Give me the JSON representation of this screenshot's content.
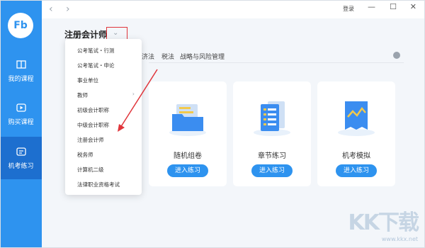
{
  "app": {
    "logo_text": "Fb"
  },
  "sidebar": {
    "items": [
      {
        "label": "我的课程"
      },
      {
        "label": "购买课程"
      },
      {
        "label": "机考练习"
      }
    ]
  },
  "topbar": {
    "back": "‹",
    "forward": "›",
    "login": "登录",
    "minimize": "—",
    "maximize": "☐",
    "close": "✕"
  },
  "header": {
    "subject": "注册会计师",
    "chevron": "⌄"
  },
  "tabs": [
    "济法",
    "税法",
    "战略与风险管理"
  ],
  "dropdown": {
    "items": [
      "公考笔试・行测",
      "公考笔试・申论",
      "事业单位",
      "教师",
      "初级会计职称",
      "中级会计职称",
      "注册会计师",
      "税务师",
      "计算机二级",
      "法律职业资格考试"
    ],
    "caret": "›"
  },
  "cards": [
    {
      "name": "随机组卷",
      "button": "进入练习"
    },
    {
      "name": "章节练习",
      "button": "进入练习"
    },
    {
      "name": "机考模拟",
      "button": "进入练习"
    }
  ],
  "watermark": {
    "logo": "KK下载",
    "url": "www.kkx.net"
  },
  "colors": {
    "accent": "#2e93ef",
    "active_nav": "#1d6fcf",
    "highlight_box": "#e0353b"
  }
}
